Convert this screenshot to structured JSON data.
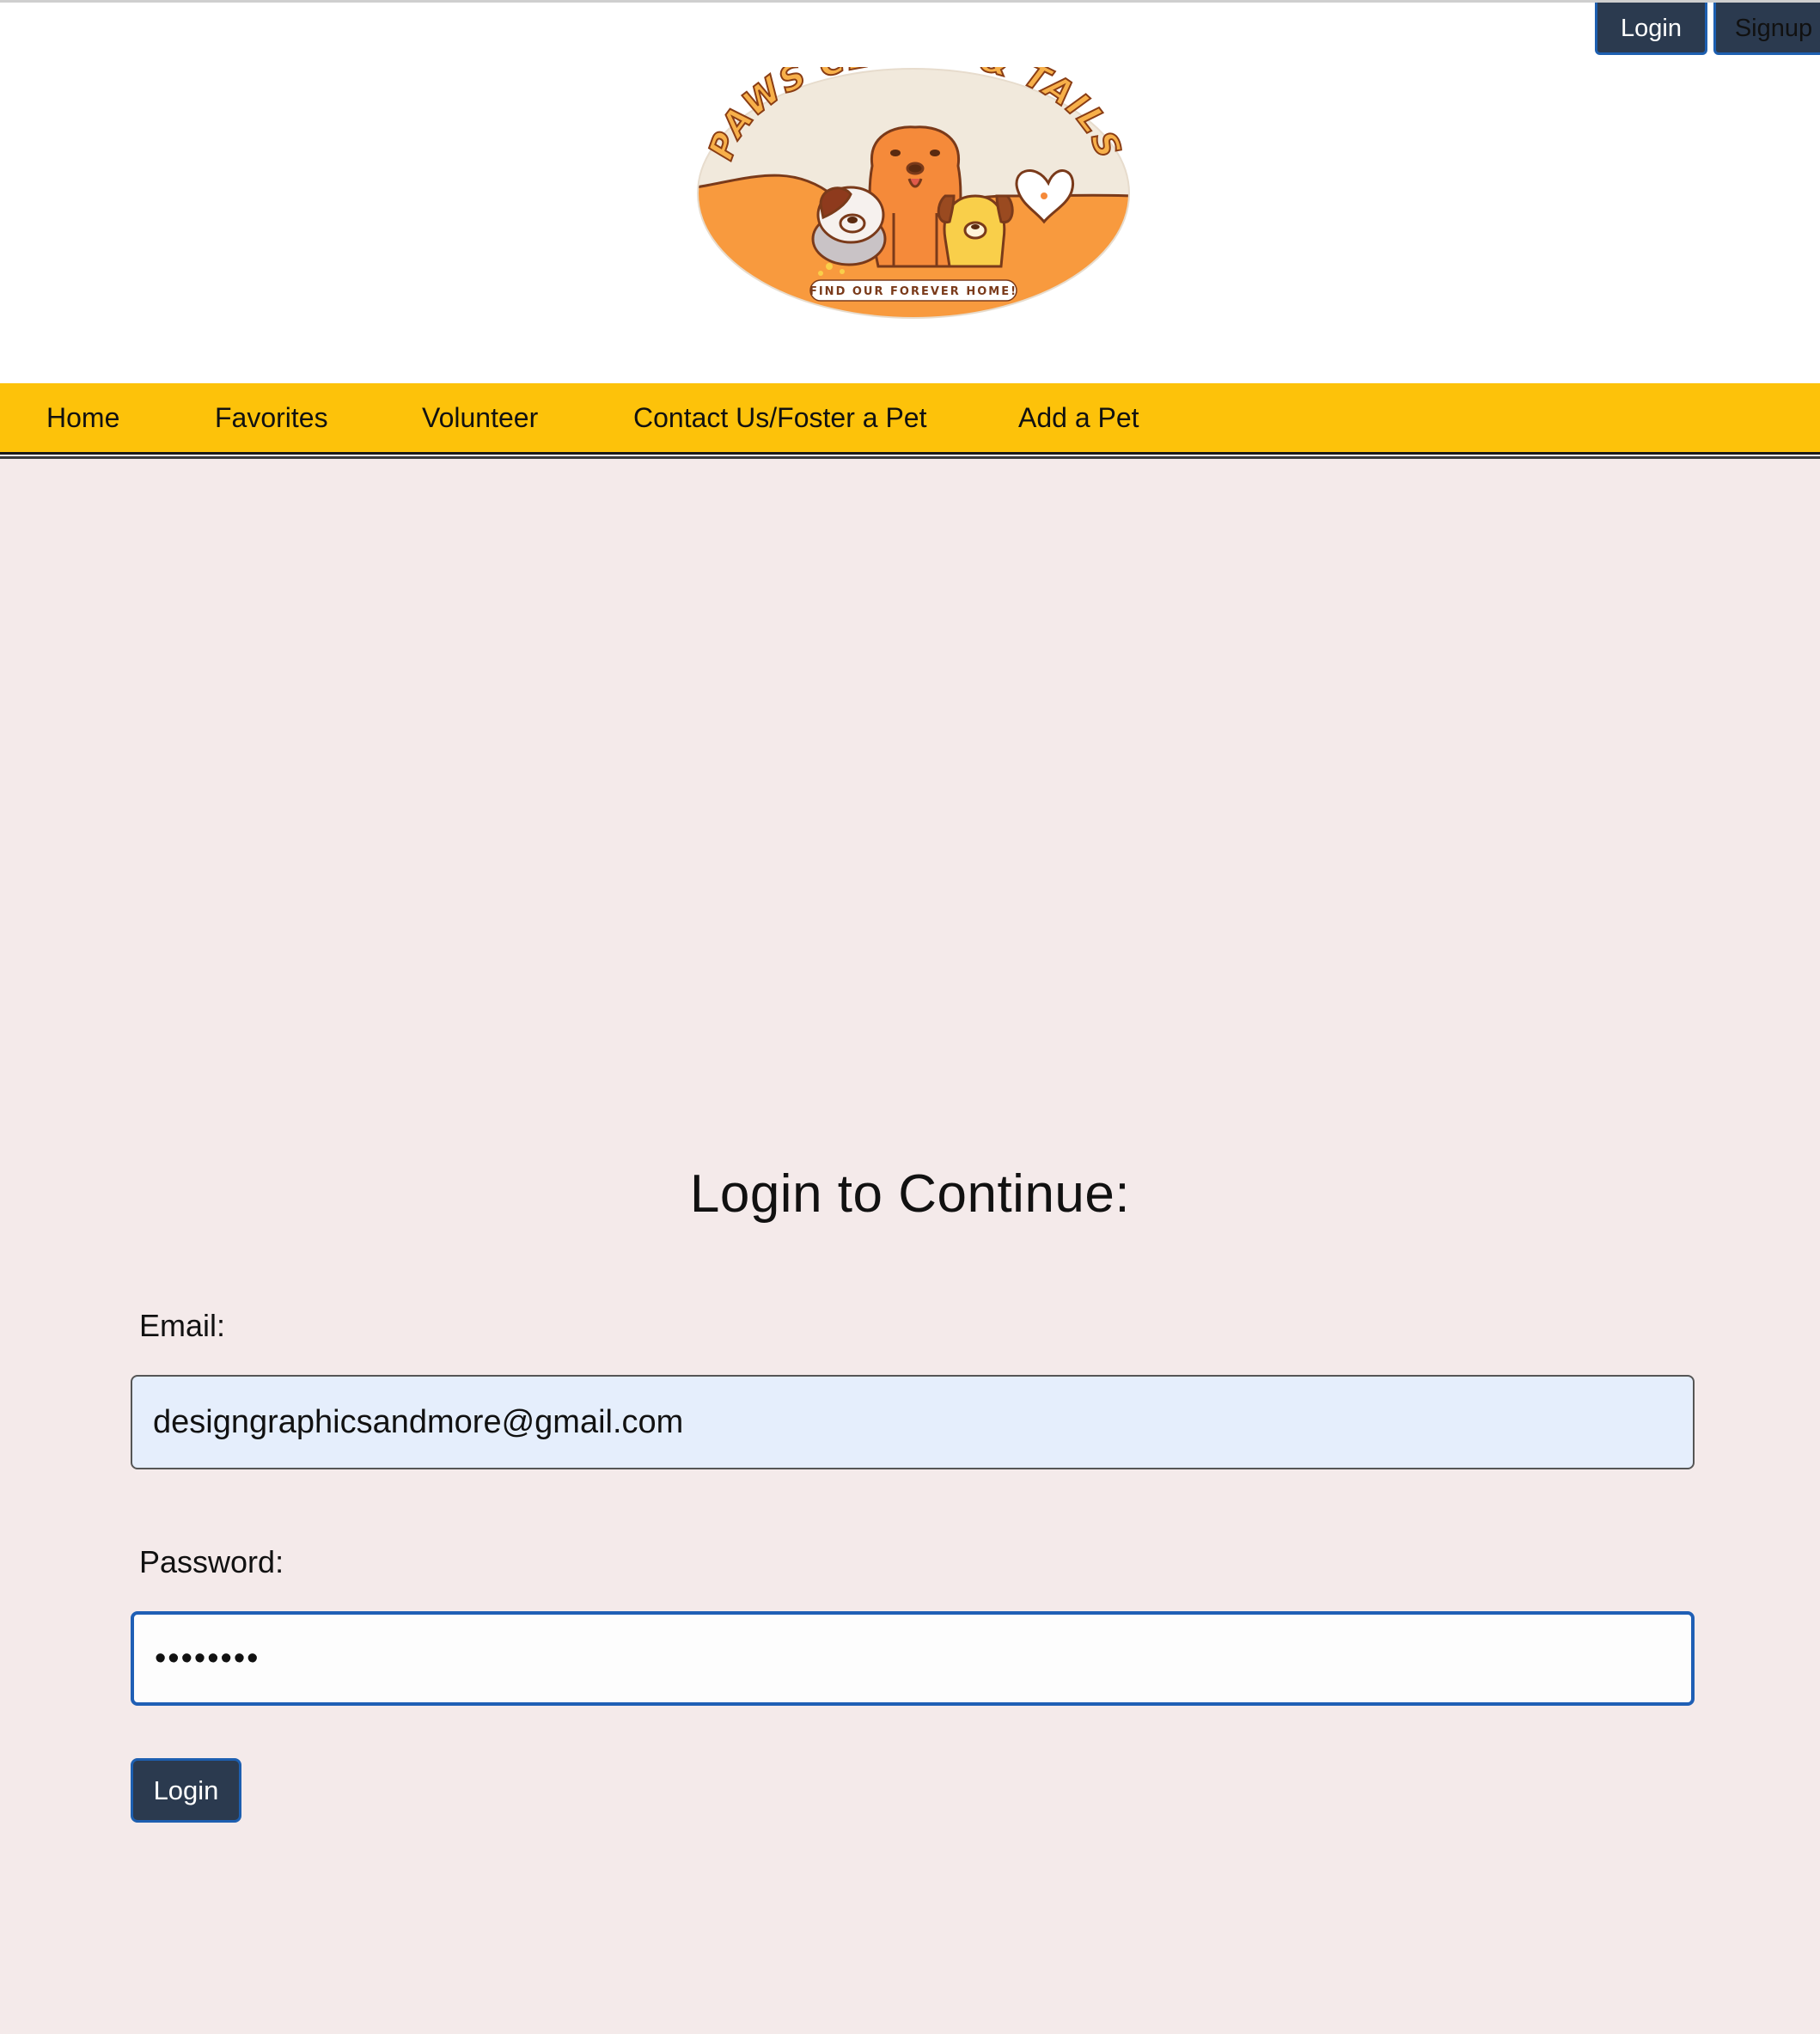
{
  "header": {
    "login_label": "Login",
    "signup_label": "Signup",
    "logo": {
      "name": "PAWS CLAWS & TAILS",
      "tagline": "FIND OUR FOREVER HOME!"
    }
  },
  "nav": {
    "items": [
      {
        "label": "Home"
      },
      {
        "label": "Favorites"
      },
      {
        "label": "Volunteer"
      },
      {
        "label": "Contact Us/Foster a Pet"
      },
      {
        "label": "Add a Pet"
      }
    ]
  },
  "login": {
    "title": "Login to Continue:",
    "email_label": "Email:",
    "email_value": "designgraphicsandmore@gmail.com",
    "password_label": "Password:",
    "password_value": "password",
    "submit_label": "Login"
  },
  "colors": {
    "nav_bg": "#fdc20a",
    "page_bg": "#f4eaea",
    "button_bg": "#2b3a4f",
    "focus_border": "#1f5fb5",
    "logo_orange": "#f89a3e"
  }
}
